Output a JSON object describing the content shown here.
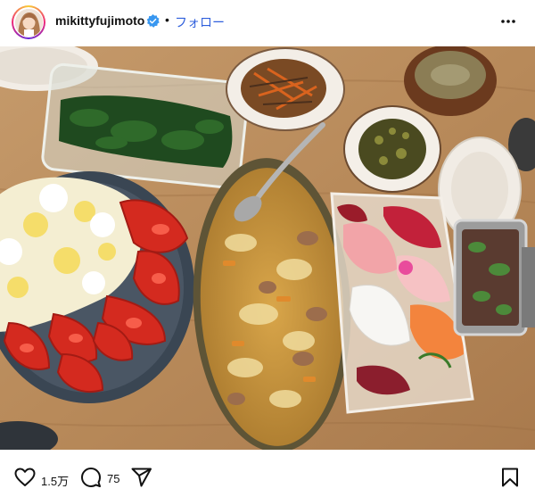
{
  "header": {
    "username": "mikittyfujimoto",
    "separator": "•",
    "follow_label": "フォロー"
  },
  "post": {
    "image_description_icons": [
      "heart-icon",
      "comment-icon",
      "share-icon",
      "bookmark-icon"
    ],
    "like_count": "1.5万",
    "comment_count": "75"
  },
  "colors": {
    "accent_blue": "#2f5fdc",
    "verified_blue": "#3897f0",
    "text": "#111111"
  }
}
